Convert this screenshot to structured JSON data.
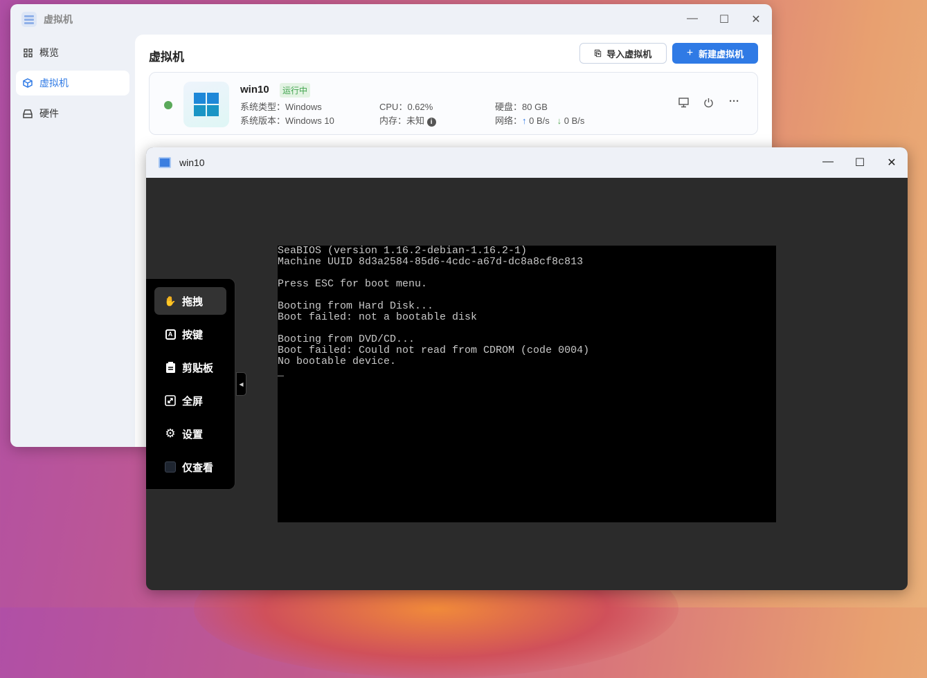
{
  "main_window": {
    "title": "虚拟机",
    "controls": {
      "minimize": "—",
      "maximize": "☐",
      "close": "✕"
    }
  },
  "sidebar": {
    "items": [
      {
        "label": "概览",
        "icon": "grid-icon"
      },
      {
        "label": "虚拟机",
        "icon": "cube-icon",
        "active": true
      },
      {
        "label": "硬件",
        "icon": "drive-icon"
      }
    ]
  },
  "page": {
    "title": "虚拟机",
    "import_label": "导入虚拟机",
    "new_label": "新建虚拟机",
    "new_icon": "+"
  },
  "vm_card": {
    "name": "win10",
    "status": "运行中",
    "os_type_label": "系统类型：",
    "os_type": "Windows",
    "os_version_label": "系统版本：",
    "os_version": "Windows 10",
    "cpu_label": "CPU：",
    "cpu": "0.62%",
    "mem_label": "内存：",
    "mem": "未知",
    "disk_label": "硬盘：",
    "disk": "80 GB",
    "net_label": "网络：",
    "net_up": "0 B/s",
    "net_down": "0 B/s",
    "status_color": "#5aa95a"
  },
  "console": {
    "title": "win10",
    "lines": [
      "SeaBIOS (version 1.16.2-debian-1.16.2-1)",
      "Machine UUID 8d3a2584-85d6-4cdc-a67d-dc8a8cf8c813",
      "",
      "Press ESC for boot menu.",
      "",
      "Booting from Hard Disk...",
      "Boot failed: not a bootable disk",
      "",
      "Booting from DVD/CD...",
      "Boot failed: Could not read from CDROM (code 0004)",
      "No bootable device.",
      "_"
    ]
  },
  "toolbar": {
    "items": [
      {
        "label": "拖拽",
        "icon": "hand-icon"
      },
      {
        "label": "按键",
        "icon": "keyboard-key-icon"
      },
      {
        "label": "剪贴板",
        "icon": "clipboard-icon"
      },
      {
        "label": "全屏",
        "icon": "fullscreen-icon"
      },
      {
        "label": "设置",
        "icon": "gear-icon"
      },
      {
        "label": "仅查看",
        "icon": "checkbox"
      }
    ]
  }
}
